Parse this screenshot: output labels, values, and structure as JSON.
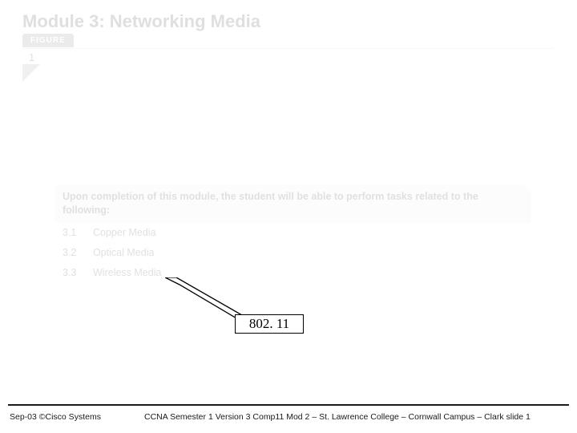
{
  "module": {
    "title": "Module 3: Networking Media",
    "figure_label": "FIGURE",
    "figure_number": "1"
  },
  "objectives": {
    "header": "Upon completion of this module, the student will be able to perform tasks related to the following:",
    "rows": [
      {
        "num": "3.1",
        "label": "Copper Media"
      },
      {
        "num": "3.2",
        "label": "Optical Media"
      },
      {
        "num": "3.3",
        "label": "Wireless Media"
      }
    ]
  },
  "callout": {
    "text": "802. 11"
  },
  "footer": {
    "left": "Sep-03 ©Cisco Systems",
    "right": "CCNA Semester 1 Version 3 Comp11 Mod 2 – St. Lawrence College – Cornwall Campus – Clark slide 1"
  }
}
